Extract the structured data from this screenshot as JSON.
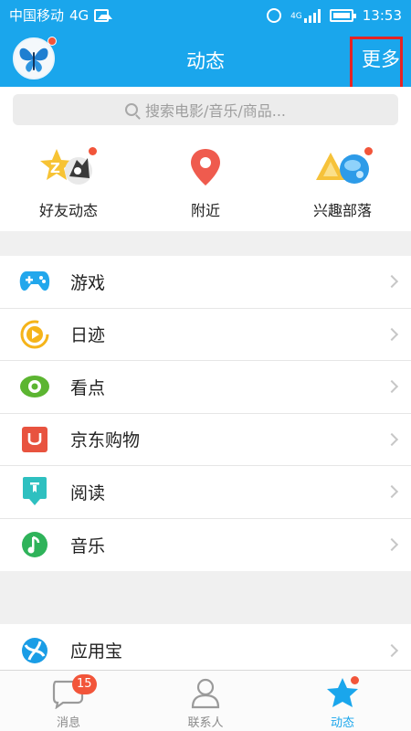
{
  "status_bar": {
    "carrier": "中国移动",
    "network": "4G",
    "signal_label": "4G",
    "time": "13:53"
  },
  "header": {
    "title": "动态",
    "more_label": "更多"
  },
  "search": {
    "placeholder": "搜索电影/音乐/商品..."
  },
  "quick_items": [
    {
      "label": "好友动态",
      "icon": "friends-feed-icon"
    },
    {
      "label": "附近",
      "icon": "location-pin-icon"
    },
    {
      "label": "兴趣部落",
      "icon": "interest-tribe-icon"
    }
  ],
  "list_items": [
    {
      "label": "游戏",
      "icon": "gamepad-icon",
      "color": "#22a7ec"
    },
    {
      "label": "日迹",
      "icon": "play-circle-icon",
      "color": "#f5b41a"
    },
    {
      "label": "看点",
      "icon": "eye-icon",
      "color": "#5cb531"
    },
    {
      "label": "京东购物",
      "icon": "jd-shopping-icon",
      "color": "#e8533f"
    },
    {
      "label": "阅读",
      "icon": "bookmark-icon",
      "color": "#2ec0c0"
    },
    {
      "label": "音乐",
      "icon": "music-note-icon",
      "color": "#2fb35a"
    }
  ],
  "list_items_2": [
    {
      "label": "应用宝",
      "icon": "app-store-icon",
      "color": "#1a9de6"
    }
  ],
  "tabs": [
    {
      "label": "消息",
      "icon": "message-bubble-icon",
      "badge": "15"
    },
    {
      "label": "联系人",
      "icon": "contacts-person-icon"
    },
    {
      "label": "动态",
      "icon": "star-icon",
      "active": true
    }
  ],
  "colors": {
    "accent": "#1aa6ec",
    "badge": "#f2553a",
    "highlight_box": "#e52323"
  }
}
